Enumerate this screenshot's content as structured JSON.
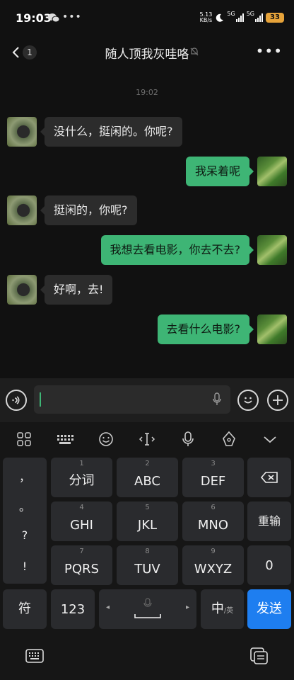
{
  "status": {
    "time": "19:03",
    "speed_value": "5.13",
    "speed_unit": "KB/s",
    "net1": "5G",
    "net2": "5G",
    "battery": "33"
  },
  "header": {
    "back_badge": "1",
    "title": "随人顶我灰哇咯"
  },
  "chat": {
    "timestamp": "19:02",
    "messages": [
      {
        "side": "in",
        "text": "没什么，挺闲的。你呢?"
      },
      {
        "side": "out",
        "text": "我呆着呢"
      },
      {
        "side": "in",
        "text": "挺闲的，你呢?"
      },
      {
        "side": "out",
        "text": "我想去看电影，你去不去?"
      },
      {
        "side": "in",
        "text": "好啊，去!"
      },
      {
        "side": "out",
        "text": "去看什么电影?"
      }
    ]
  },
  "input": {
    "value": ""
  },
  "keyboard": {
    "toolbar": [
      "grid-icon",
      "keyboard-icon",
      "emoji-icon",
      "cursor-icon",
      "mic-icon",
      "pen-icon",
      "chevron-down-icon"
    ],
    "punctuation": [
      "，",
      "。",
      "?",
      "!"
    ],
    "rows": [
      [
        {
          "num": "1",
          "label": "分词"
        },
        {
          "num": "2",
          "label": "ABC"
        },
        {
          "num": "3",
          "label": "DEF"
        }
      ],
      [
        {
          "num": "4",
          "label": "GHI"
        },
        {
          "num": "5",
          "label": "JKL"
        },
        {
          "num": "6",
          "label": "MNO"
        }
      ],
      [
        {
          "num": "7",
          "label": "PQRS"
        },
        {
          "num": "8",
          "label": "TUV"
        },
        {
          "num": "9",
          "label": "WXYZ"
        }
      ]
    ],
    "relearn": "重输",
    "zero": "0",
    "symbol": "符",
    "numeric": "123",
    "lang_main": "中",
    "lang_sub": "/英",
    "send": "发送"
  },
  "colors": {
    "accent": "#3eb575",
    "send": "#1e7ef0",
    "key_bg": "#2a2b2e"
  }
}
